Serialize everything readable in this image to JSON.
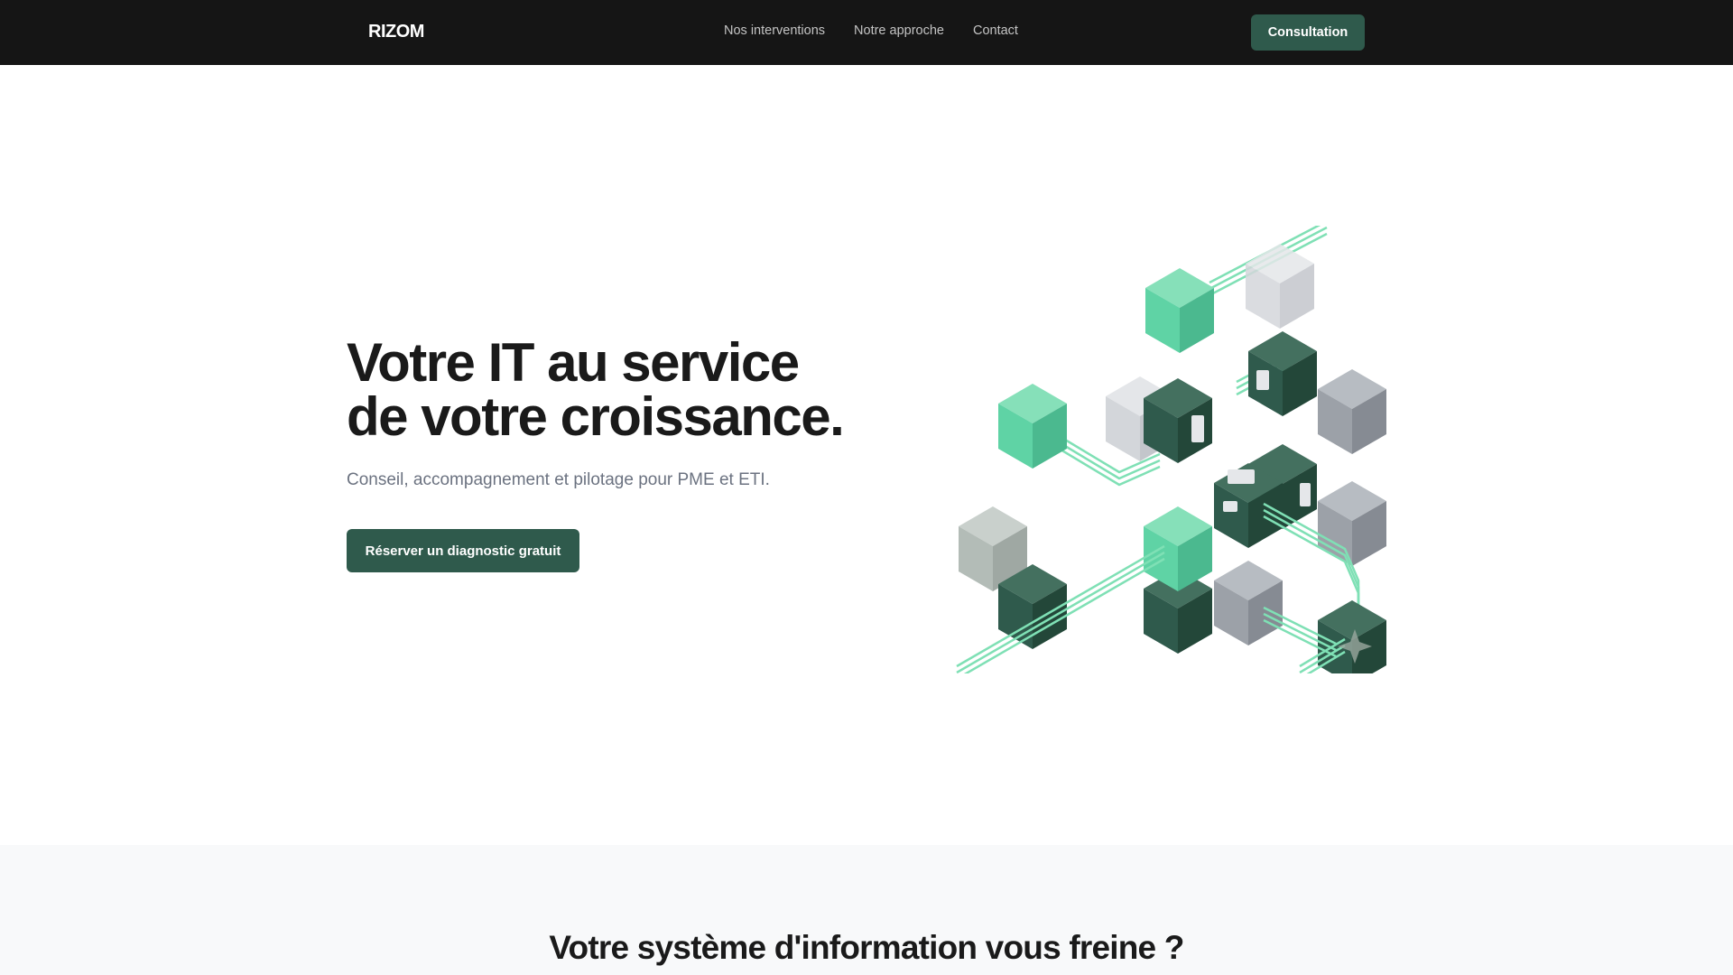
{
  "nav": {
    "logo": "RIZOM",
    "links": [
      "Nos interventions",
      "Notre approche",
      "Contact"
    ],
    "cta": "Consultation"
  },
  "hero": {
    "title_line1": "Votre IT au service",
    "title_line2": "de votre croissance.",
    "subtitle": "Conseil, accompagnement et pilotage pour PME et ETI.",
    "button": "Réserver un diagnostic gratuit"
  },
  "section2": {
    "heading": "Votre système d'information vous freine ?"
  },
  "colors": {
    "nav_bg": "#151515",
    "accent": "#2f5a4c",
    "mint": "#5fd3a5",
    "section_bg": "#f8f9fa"
  }
}
